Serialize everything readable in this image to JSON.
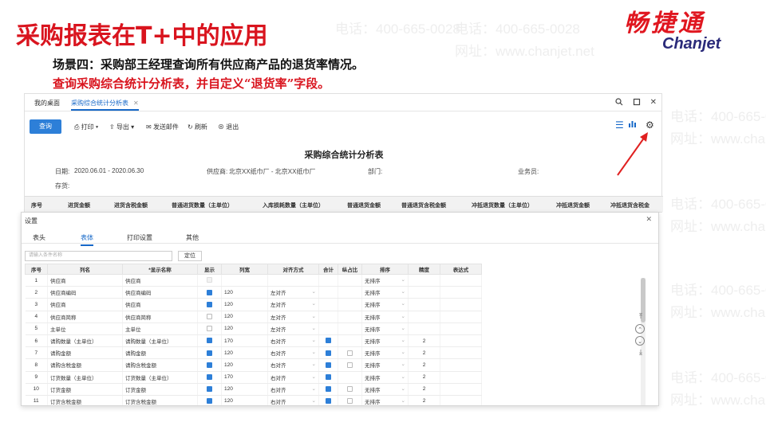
{
  "slide": {
    "title": "采购报表在T+中的应用",
    "scene": "场景四：采购部王经理查询所有供应商产品的退货率情况。",
    "task": "查询采购综合统计分析表，并自定义“退货率”字段。",
    "brand_cn": "畅捷通",
    "brand_en": "Chanjet",
    "watermark_phone": "电话：400-665-0028",
    "watermark_site": "网址：www.chanjet.net"
  },
  "app": {
    "tabs": [
      {
        "label": "我的桌面",
        "active": false
      },
      {
        "label": "采购综合统计分析表",
        "active": true
      }
    ],
    "window_icons": [
      "search-icon",
      "restore-icon",
      "close-icon"
    ],
    "toolbar": {
      "query": "查询",
      "print": "打印",
      "export": "导出",
      "send_mail": "发送邮件",
      "refresh": "刷新",
      "exit": "退出"
    },
    "report_title": "采购综合统计分析表",
    "meta": {
      "date_label": "日期:",
      "date_value": "2020.06.01 - 2020.06.30",
      "supplier_label": "供应商:",
      "supplier_value": "北京XX纸巾厂 - 北京XX纸巾厂",
      "dept_label": "部门:",
      "salesman_label": "业务员:",
      "warehouse_label": "存货:"
    },
    "columns": [
      "序号",
      "进货金额",
      "进货含税金额",
      "普通进货数量（主单位）",
      "入库损耗数量（主单位）",
      "普通退货金额",
      "普通退货含税金额",
      "冲抵退货数量（主单位）",
      "冲抵退货金额",
      "冲抵退货含税金"
    ]
  },
  "dialog": {
    "title": "设置",
    "tabs": [
      {
        "label": "表头",
        "active": false
      },
      {
        "label": "表体",
        "active": true
      },
      {
        "label": "打印设置",
        "active": false
      },
      {
        "label": "其他",
        "active": false
      }
    ],
    "search_placeholder": "请输入条件名称",
    "locate_button": "定位",
    "columns": [
      "序号",
      "列名",
      "*显示名称",
      "显示",
      "列宽",
      "对齐方式",
      "合计",
      "纵占比",
      "排序",
      "精度",
      "表达式"
    ],
    "rows": [
      {
        "no": "1",
        "name": "供应商",
        "display": "供应商",
        "show": "disabled",
        "width": "",
        "align": "",
        "sum": "none",
        "ratio": "none",
        "sort": "无排序",
        "precision": "",
        "indent": false
      },
      {
        "no": "2",
        "name": "供应商编码",
        "display": "供应商编码",
        "show": "on",
        "width": "120",
        "align": "左对齐",
        "sum": "none",
        "ratio": "none",
        "sort": "无排序",
        "precision": "",
        "indent": true
      },
      {
        "no": "3",
        "name": "供应商",
        "display": "供应商",
        "show": "on",
        "width": "120",
        "align": "左对齐",
        "sum": "none",
        "ratio": "none",
        "sort": "无排序",
        "precision": "",
        "indent": true
      },
      {
        "no": "4",
        "name": "供应商简称",
        "display": "供应商简称",
        "show": "off",
        "width": "120",
        "align": "左对齐",
        "sum": "none",
        "ratio": "none",
        "sort": "无排序",
        "precision": "",
        "indent": true
      },
      {
        "no": "5",
        "name": "主单位",
        "display": "主单位",
        "show": "off",
        "width": "120",
        "align": "左对齐",
        "sum": "none",
        "ratio": "none",
        "sort": "无排序",
        "precision": "",
        "indent": false
      },
      {
        "no": "6",
        "name": "请购数量（主单位）",
        "display": "请购数量（主单位）",
        "show": "on",
        "width": "170",
        "align": "右对齐",
        "sum": "on",
        "ratio": "none",
        "sort": "无排序",
        "precision": "2",
        "indent": false
      },
      {
        "no": "7",
        "name": "请购金额",
        "display": "请购金额",
        "show": "on",
        "width": "120",
        "align": "右对齐",
        "sum": "on",
        "ratio": "off",
        "sort": "无排序",
        "precision": "2",
        "indent": false
      },
      {
        "no": "8",
        "name": "请购含税金额",
        "display": "请购含税金额",
        "show": "on",
        "width": "120",
        "align": "右对齐",
        "sum": "on",
        "ratio": "off",
        "sort": "无排序",
        "precision": "2",
        "indent": false
      },
      {
        "no": "9",
        "name": "订货数量（主单位）",
        "display": "订货数量（主单位）",
        "show": "on",
        "width": "170",
        "align": "右对齐",
        "sum": "on",
        "ratio": "none",
        "sort": "无排序",
        "precision": "2",
        "indent": false
      },
      {
        "no": "10",
        "name": "订货金额",
        "display": "订货金额",
        "show": "on",
        "width": "120",
        "align": "右对齐",
        "sum": "on",
        "ratio": "off",
        "sort": "无排序",
        "precision": "2",
        "indent": false
      },
      {
        "no": "11",
        "name": "订货含税金额",
        "display": "订货含税金额",
        "show": "on",
        "width": "120",
        "align": "右对齐",
        "sum": "on",
        "ratio": "off",
        "sort": "无排序",
        "precision": "2",
        "indent": false
      }
    ]
  },
  "colors": {
    "title_red": "#d9141e",
    "accent_blue": "#2d7fd8",
    "brand_navy": "#2b2b7a"
  }
}
